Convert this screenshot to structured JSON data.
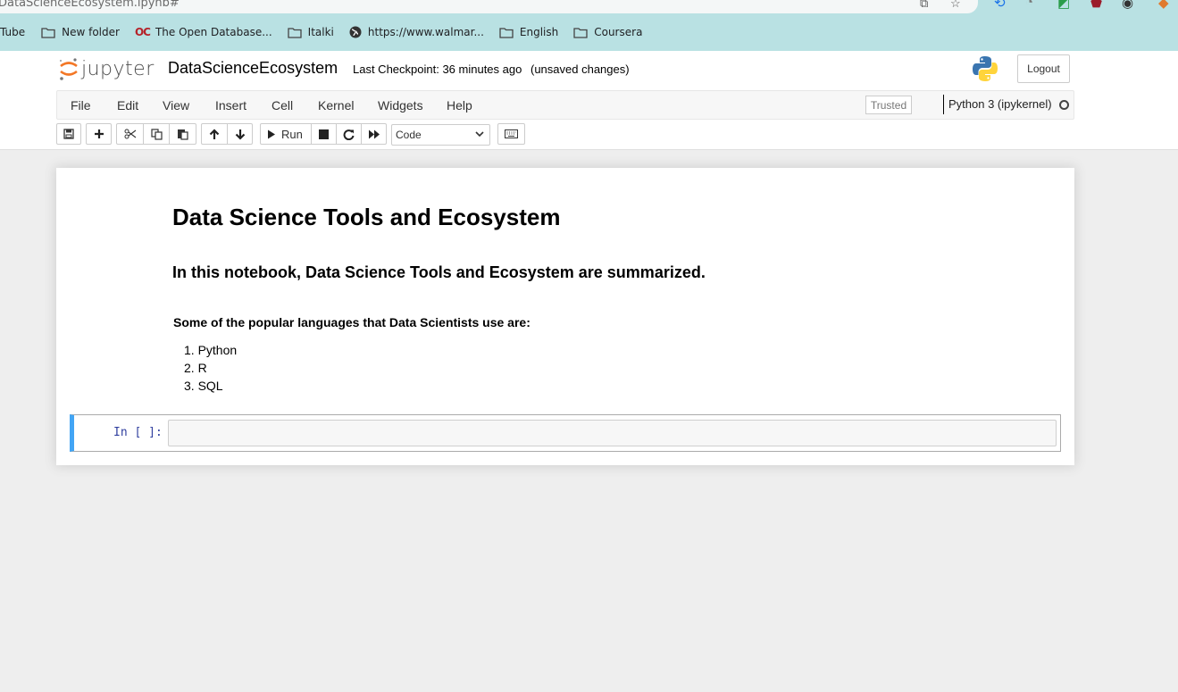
{
  "browser": {
    "url_text": "DataScienceEcosystem.ipynb#",
    "bookmarks": [
      {
        "label": "Tube",
        "icon": "none"
      },
      {
        "label": "New folder",
        "icon": "folder-icon"
      },
      {
        "label": "The Open Database...",
        "icon": "oc-logo-icon",
        "logo_text": "OC"
      },
      {
        "label": "Italki",
        "icon": "folder-icon"
      },
      {
        "label": "https://www.walmar...",
        "icon": "globe-icon"
      },
      {
        "label": "English",
        "icon": "folder-icon"
      },
      {
        "label": "Coursera",
        "icon": "folder-icon"
      }
    ]
  },
  "header": {
    "logo_text": "jupyter",
    "notebook_name": "DataScienceEcosystem",
    "checkpoint": "Last Checkpoint: 36 minutes ago",
    "unsaved": "(unsaved changes)",
    "logout_label": "Logout"
  },
  "menubar": {
    "items": [
      "File",
      "Edit",
      "View",
      "Insert",
      "Cell",
      "Kernel",
      "Widgets",
      "Help"
    ],
    "trusted_label": "Trusted",
    "kernel_name": "Python 3 (ipykernel)"
  },
  "toolbar": {
    "run_label": "Run",
    "cell_type": "Code"
  },
  "notebook": {
    "heading1": "Data Science Tools and Ecosystem",
    "heading3": "In this notebook, Data Science Tools and Ecosystem are summarized.",
    "heading5": "Some of the popular languages that Data Scientists use are:",
    "languages": [
      "1. Python",
      "2. R",
      "3. SQL"
    ],
    "code_prompt": "In [ ]:"
  },
  "colors": {
    "browser_bar": "#b9e1e3",
    "cell_selected_border": "#42a5f5",
    "prompt_color": "#303f9f"
  }
}
